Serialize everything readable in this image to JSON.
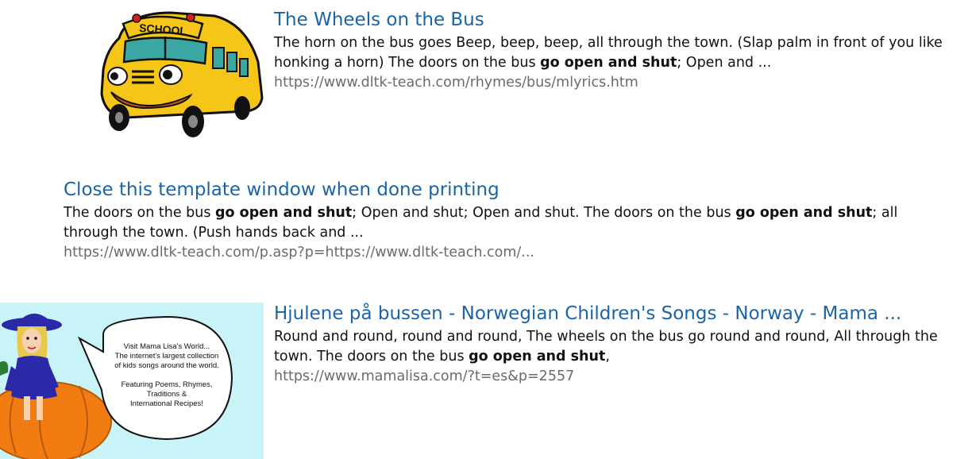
{
  "results": [
    {
      "title": "The Wheels on the Bus",
      "snippet": [
        {
          "text": "The horn on the bus goes Beep, beep, beep, all through the town. (Slap palm in front of you like honking a horn) The doors on the bus ",
          "bold": false
        },
        {
          "text": "go open and shut",
          "bold": true
        },
        {
          "text": "; Open and ...",
          "bold": false
        }
      ],
      "url": "https://www.dltk-teach.com/rhymes/bus/mlyrics.htm",
      "thumbnail": {
        "icon": "school-bus-icon",
        "sign_text": "SCHOOL"
      }
    },
    {
      "title": "Close this template window when done printing",
      "snippet": [
        {
          "text": "The doors on the bus ",
          "bold": false
        },
        {
          "text": "go open and shut",
          "bold": true
        },
        {
          "text": "; Open and shut; Open and shut. The doors on the bus ",
          "bold": false
        },
        {
          "text": "go open and shut",
          "bold": true
        },
        {
          "text": "; all through the town. (Push hands back and ...",
          "bold": false
        }
      ],
      "url": "https://www.dltk-teach.com/p.asp?p=https://www.dltk-teach.com/..."
    },
    {
      "title": "Hjulene på bussen - Norwegian Children's Songs - Norway - Mama ...",
      "snippet": [
        {
          "text": "Round and round, round and round, The wheels on the bus go round and round, All through the town. The doors on the bus ",
          "bold": false
        },
        {
          "text": "go open and shut",
          "bold": true
        },
        {
          "text": ",",
          "bold": false
        }
      ],
      "url": "https://www.mamalisa.com/?t=es&p=2557",
      "thumbnail": {
        "icon": "mama-lisa-pumpkin-icon",
        "bubble_lines": [
          "Visit Mama Lisa's World...",
          "The internet's largest collection",
          "of kids songs around the world.",
          "",
          "Featuring Poems, Rhymes,",
          "Traditions &",
          "International Recipes!"
        ]
      }
    }
  ],
  "colors": {
    "title": "#1a64a8",
    "url": "#6b6b6b",
    "bus_yellow": "#f5c518",
    "thumb_bg": "#c8f4f8",
    "pumpkin": "#f07c12"
  }
}
